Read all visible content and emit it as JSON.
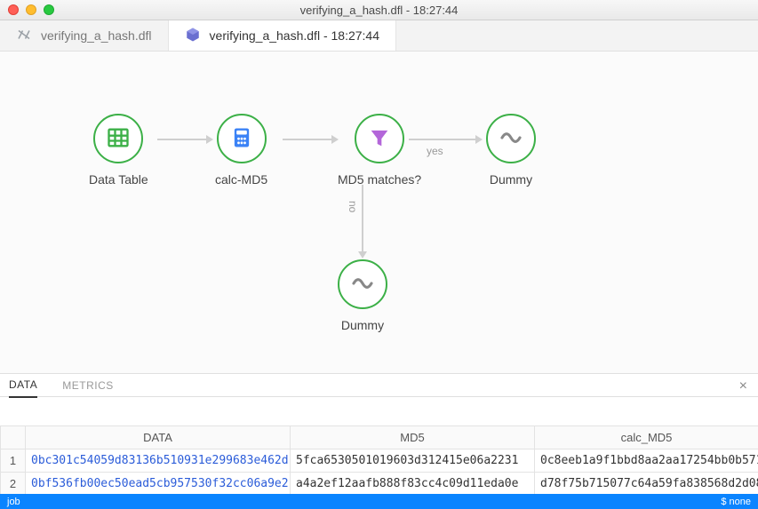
{
  "window": {
    "title": "verifying_a_hash.dfl - 18:27:44"
  },
  "tabs": [
    {
      "label": "verifying_a_hash.dfl",
      "active": false
    },
    {
      "label": "verifying_a_hash.dfl - 18:27:44",
      "active": true
    }
  ],
  "nodes": {
    "data_table": "Data Table",
    "calc_md5": "calc-MD5",
    "md5_matches": "MD5 matches?",
    "dummy_yes": "Dummy",
    "dummy_no": "Dummy"
  },
  "edges": {
    "yes": "yes",
    "no": "no"
  },
  "bottom_tabs": {
    "data": "DATA",
    "metrics": "METRICS"
  },
  "table": {
    "columns": [
      "",
      "DATA",
      "MD5",
      "calc_MD5"
    ],
    "rows": [
      {
        "n": "1",
        "data": "0bc301c54059d83136b510931e299683e462d",
        "md5": "5fca6530501019603d312415e06a2231",
        "calc": "0c8eeb1a9f1bbd8aa2aa17254bb0b571"
      },
      {
        "n": "2",
        "data": "0bf536fb00ec50ead5cb957530f32cc06a9e2",
        "md5": "a4a2ef12aafb888f83cc4c09d11eda0e",
        "calc": "d78f75b715077c64a59fa838568d2d08"
      }
    ]
  },
  "status": {
    "left": "job",
    "right": "$ none"
  }
}
